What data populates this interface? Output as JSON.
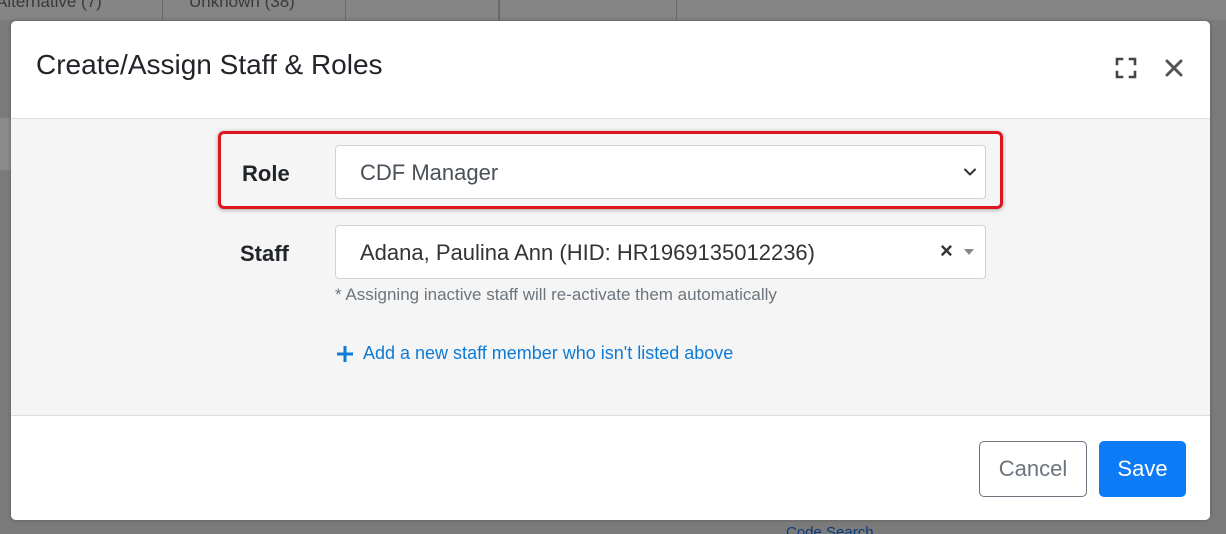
{
  "modal": {
    "title": "Create/Assign Staff & Roles"
  },
  "background": {
    "tabs": [
      "Alternative (7)",
      "Unknown (38)"
    ],
    "partial_link": "Code Search"
  },
  "form": {
    "role": {
      "label": "Role",
      "selected": "CDF Manager"
    },
    "staff": {
      "label": "Staff",
      "selected": "Adana, Paulina Ann (HID: HR1969135012236)",
      "help_text": "* Assigning inactive staff will re-activate them automatically"
    },
    "add_link": "Add a new staff member who isn't listed above"
  },
  "footer": {
    "cancel_label": "Cancel",
    "save_label": "Save"
  },
  "colors": {
    "highlight": "#e0141e",
    "primary": "#0d7bf6",
    "link": "#0d7bd6"
  }
}
